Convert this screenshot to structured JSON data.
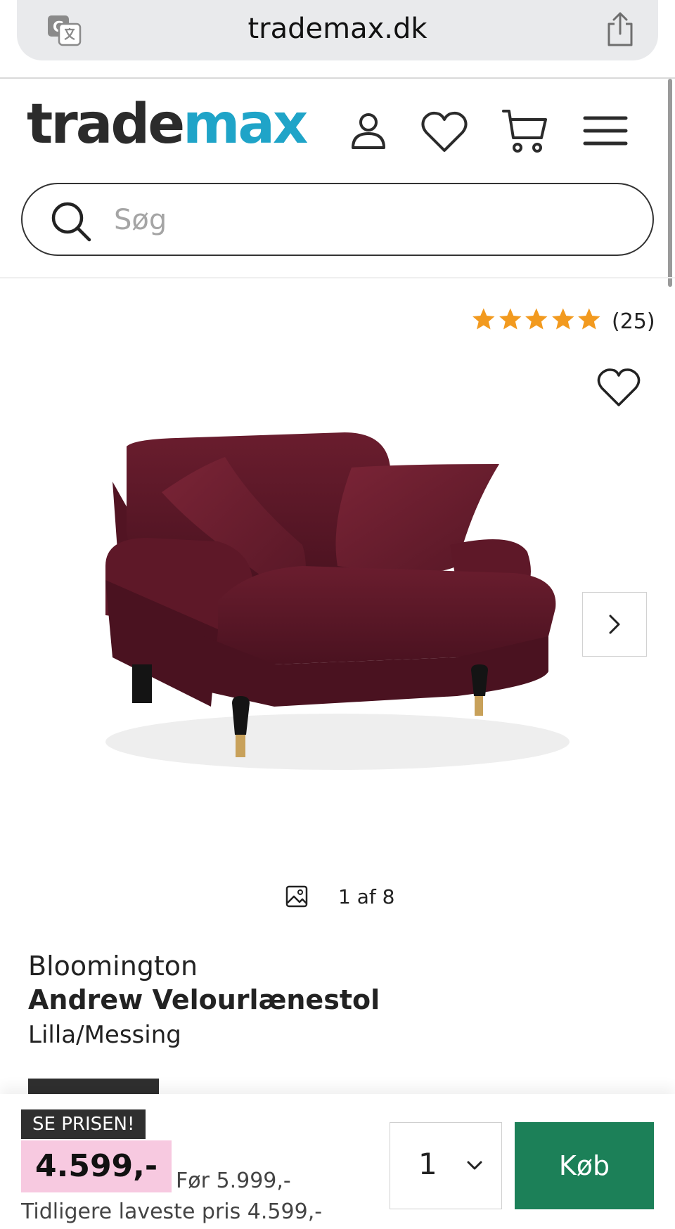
{
  "browser": {
    "domain": "trademax.dk",
    "icons": [
      "translate-icon",
      "share-icon"
    ]
  },
  "header": {
    "logo_part1": "trade",
    "logo_part2": "max",
    "icons": [
      "account-icon",
      "heart-icon",
      "cart-icon",
      "menu-icon"
    ],
    "colors": {
      "logo_dark": "#2b2b2b",
      "logo_accent": "#1fa4c8"
    }
  },
  "search": {
    "placeholder": "Søg"
  },
  "rating": {
    "stars": 5,
    "max_stars": 5,
    "count_text": "(25)",
    "star_color": "#f29a1f"
  },
  "gallery": {
    "counter": "1 af 8"
  },
  "product": {
    "brand": "Bloomington",
    "name": "Andrew Velourlænestol",
    "variant": "Lilla/Messing",
    "image_color": "#5d1727"
  },
  "purchase": {
    "badge": "SE PRISEN!",
    "price": "4.599,-",
    "before_price": "Før 5.999,-",
    "lowest_price": "Tidligere laveste pris 4.599,-",
    "quantity": "1",
    "buy_label": "Køb",
    "colors": {
      "price_bg": "#f7c9e0",
      "buy_bg": "#1c8058"
    }
  }
}
